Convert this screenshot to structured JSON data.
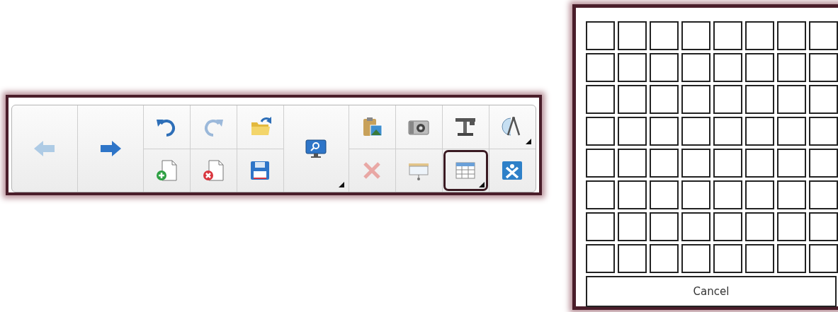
{
  "toolbar": {
    "columns": [
      {
        "kind": "single",
        "buttons": [
          {
            "kind": "back",
            "disabled": true,
            "dropdown": false,
            "highlighted": false
          }
        ]
      },
      {
        "kind": "single",
        "buttons": [
          {
            "kind": "forward",
            "disabled": false,
            "dropdown": false,
            "highlighted": false
          }
        ]
      },
      {
        "kind": "pair",
        "buttons": [
          {
            "kind": "undo",
            "disabled": false,
            "dropdown": false,
            "highlighted": false
          },
          {
            "kind": "new-page",
            "disabled": false,
            "dropdown": false,
            "highlighted": false
          }
        ]
      },
      {
        "kind": "pair",
        "buttons": [
          {
            "kind": "redo",
            "disabled": true,
            "dropdown": false,
            "highlighted": false
          },
          {
            "kind": "delete-page",
            "disabled": false,
            "dropdown": false,
            "highlighted": false
          }
        ]
      },
      {
        "kind": "pair",
        "buttons": [
          {
            "kind": "open",
            "disabled": false,
            "dropdown": false,
            "highlighted": false
          },
          {
            "kind": "save",
            "disabled": false,
            "dropdown": false,
            "highlighted": false
          }
        ]
      },
      {
        "kind": "single",
        "buttons": [
          {
            "kind": "display",
            "disabled": false,
            "dropdown": true,
            "highlighted": false
          }
        ]
      },
      {
        "kind": "pair",
        "buttons": [
          {
            "kind": "paste",
            "disabled": false,
            "dropdown": false,
            "highlighted": false
          },
          {
            "kind": "delete",
            "disabled": true,
            "dropdown": false,
            "highlighted": false
          }
        ]
      },
      {
        "kind": "pair",
        "buttons": [
          {
            "kind": "camera",
            "disabled": false,
            "dropdown": false,
            "highlighted": false
          },
          {
            "kind": "screen-shade",
            "disabled": false,
            "dropdown": false,
            "highlighted": false
          }
        ]
      },
      {
        "kind": "pair",
        "buttons": [
          {
            "kind": "document-camera",
            "disabled": false,
            "dropdown": false,
            "highlighted": false
          },
          {
            "kind": "table",
            "disabled": false,
            "dropdown": true,
            "highlighted": true
          }
        ]
      },
      {
        "kind": "pair",
        "buttons": [
          {
            "kind": "measurement-tools",
            "disabled": false,
            "dropdown": true,
            "highlighted": false
          },
          {
            "kind": "smart-tools",
            "disabled": false,
            "dropdown": false,
            "highlighted": false
          }
        ]
      }
    ]
  },
  "table_picker": {
    "rows": [
      {
        "cells": [
          {
            "selected": false
          },
          {
            "selected": false
          },
          {
            "selected": false
          },
          {
            "selected": false
          },
          {
            "selected": false
          },
          {
            "selected": false
          },
          {
            "selected": false
          },
          {
            "selected": false
          }
        ]
      },
      {
        "cells": [
          {
            "selected": false
          },
          {
            "selected": false
          },
          {
            "selected": false
          },
          {
            "selected": false
          },
          {
            "selected": false
          },
          {
            "selected": false
          },
          {
            "selected": false
          },
          {
            "selected": false
          }
        ]
      },
      {
        "cells": [
          {
            "selected": false
          },
          {
            "selected": false
          },
          {
            "selected": false
          },
          {
            "selected": false
          },
          {
            "selected": false
          },
          {
            "selected": false
          },
          {
            "selected": false
          },
          {
            "selected": false
          }
        ]
      },
      {
        "cells": [
          {
            "selected": false
          },
          {
            "selected": false
          },
          {
            "selected": false
          },
          {
            "selected": false
          },
          {
            "selected": false
          },
          {
            "selected": false
          },
          {
            "selected": false
          },
          {
            "selected": false
          }
        ]
      },
      {
        "cells": [
          {
            "selected": false
          },
          {
            "selected": false
          },
          {
            "selected": false
          },
          {
            "selected": false
          },
          {
            "selected": false
          },
          {
            "selected": false
          },
          {
            "selected": false
          },
          {
            "selected": false
          }
        ]
      },
      {
        "cells": [
          {
            "selected": false
          },
          {
            "selected": false
          },
          {
            "selected": false
          },
          {
            "selected": false
          },
          {
            "selected": false
          },
          {
            "selected": false
          },
          {
            "selected": false
          },
          {
            "selected": false
          }
        ]
      },
      {
        "cells": [
          {
            "selected": false
          },
          {
            "selected": false
          },
          {
            "selected": false
          },
          {
            "selected": false
          },
          {
            "selected": false
          },
          {
            "selected": false
          },
          {
            "selected": false
          },
          {
            "selected": false
          }
        ]
      },
      {
        "cells": [
          {
            "selected": false
          },
          {
            "selected": false
          },
          {
            "selected": false
          },
          {
            "selected": false
          },
          {
            "selected": false
          },
          {
            "selected": false
          },
          {
            "selected": false
          },
          {
            "selected": false
          }
        ]
      }
    ],
    "cancel_button": "Cancel"
  }
}
